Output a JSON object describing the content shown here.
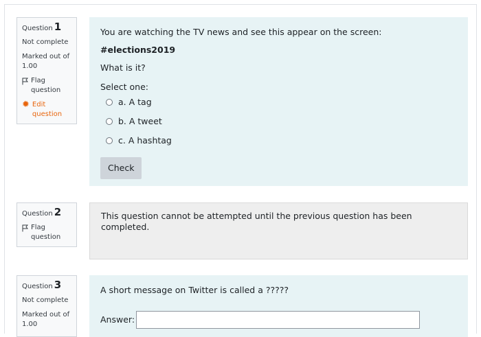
{
  "questions": [
    {
      "label": "Question",
      "number": "1",
      "state": "Not complete",
      "marked": "Marked out of 1.00",
      "flag": "Flag question",
      "edit": "Edit question",
      "text": "You are watching the TV news and see this appear on the screen:",
      "highlight": "#elections2019",
      "question": "What is it?",
      "prompt": "Select one:",
      "options": [
        "a. A tag",
        "b. A tweet",
        "c. A hashtag"
      ],
      "button": "Check"
    },
    {
      "label": "Question",
      "number": "2",
      "flag": "Flag question",
      "text": "This question cannot be attempted until the previous question has been completed."
    },
    {
      "label": "Question",
      "number": "3",
      "state": "Not complete",
      "marked": "Marked out of 1.00",
      "text": "A short message on Twitter is called a ?????",
      "answer_label": "Answer:"
    }
  ]
}
